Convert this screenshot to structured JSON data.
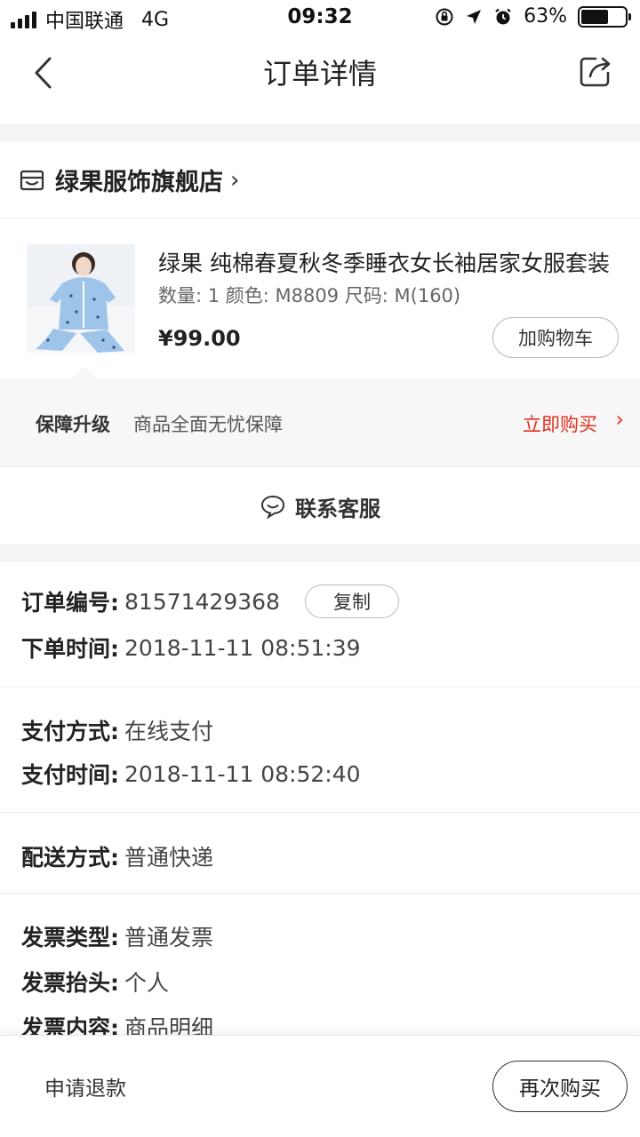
{
  "status_bar": {
    "carrier": "中国联通",
    "network": "4G",
    "time": "09:32",
    "battery": "63%",
    "battery_level": 0.63
  },
  "nav": {
    "title": "订单详情",
    "back_icon": "chevron-left-icon",
    "share_icon": "share-icon"
  },
  "shop": {
    "name": "绿果服饰旗舰店",
    "arrow": "›",
    "icon": "store-icon"
  },
  "product": {
    "title": "绿果 纯棉春夏秋冬季睡衣女长袖居家女服套装",
    "spec": "数量: 1 颜色: M8809 尺码: M(160)",
    "price": "¥99.00",
    "cart_label": "加购物车"
  },
  "guarantee": {
    "label": "保障升级",
    "description": "商品全面无忧保障",
    "buy_label": "立即购买",
    "arrow": "›"
  },
  "contact": {
    "label": "联系客服",
    "icon": "chat-icon"
  },
  "order": {
    "number_key": "订单编号:",
    "number_val": "81571429368",
    "copy_label": "复制",
    "time_key": "下单时间:",
    "time_val": "2018-11-11 08:51:39"
  },
  "payment": {
    "method_key": "支付方式:",
    "method_val": "在线支付",
    "time_key": "支付时间:",
    "time_val": "2018-11-11 08:52:40"
  },
  "delivery": {
    "method_key": "配送方式:",
    "method_val": "普通快递"
  },
  "invoice": {
    "type_key": "发票类型:",
    "type_val": "普通发票",
    "title_key": "发票抬头:",
    "title_val": "个人",
    "content_key": "发票内容:",
    "content_val": "商品明细"
  },
  "bottom_bar": {
    "refund_label": "申请退款",
    "rebuy_label": "再次购买"
  }
}
